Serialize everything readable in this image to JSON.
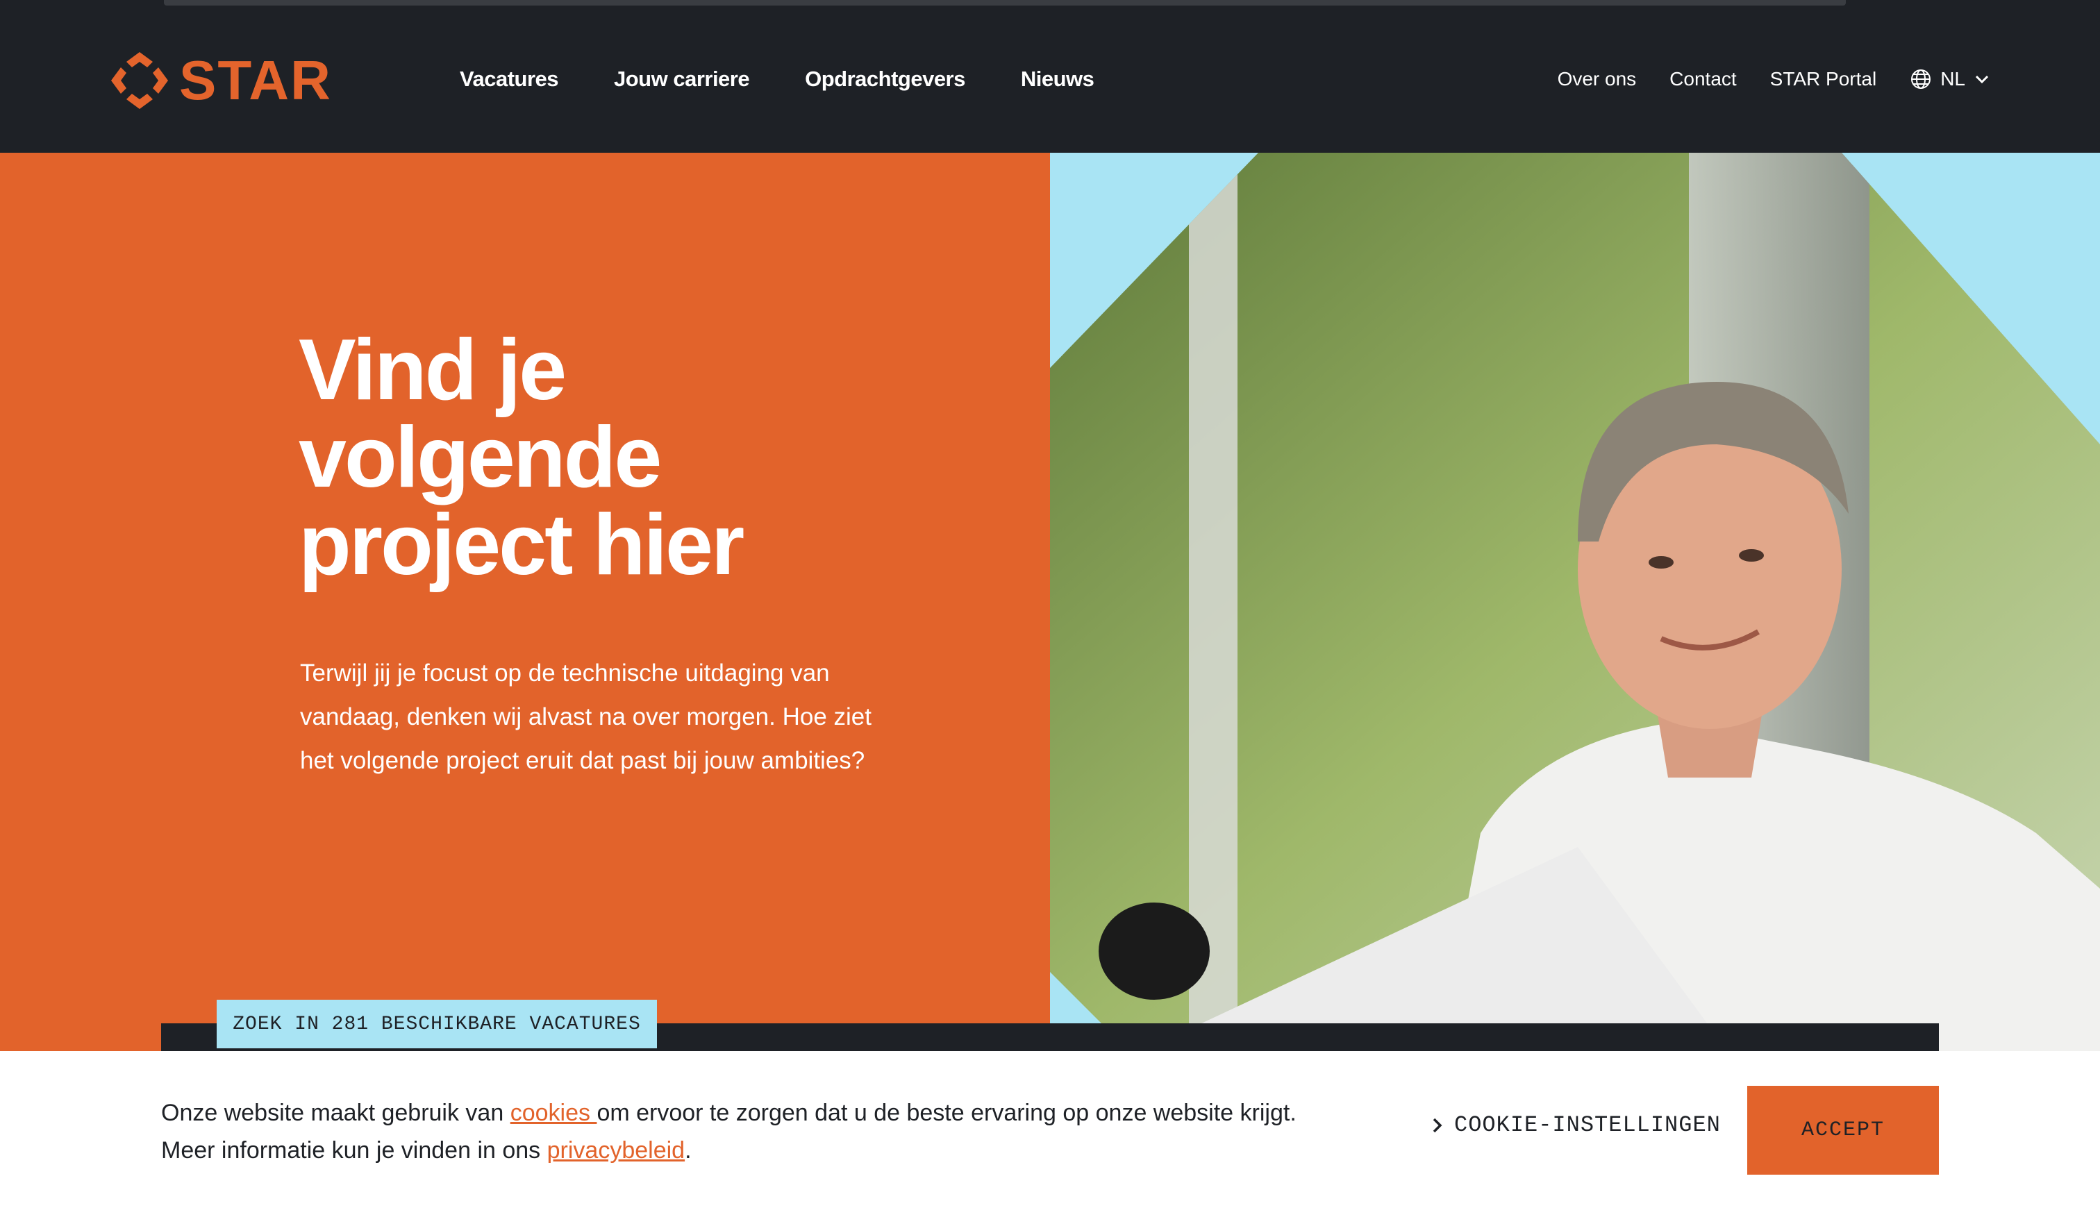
{
  "brand": {
    "name": "STAR",
    "accent": "#e2632b",
    "dark": "#1e2126",
    "light_blue": "#a9e4f4"
  },
  "nav": {
    "main": [
      "Vacatures",
      "Jouw carriere",
      "Opdrachtgevers",
      "Nieuws"
    ],
    "utility": [
      "Over ons",
      "Contact",
      "STAR Portal"
    ],
    "language": "NL",
    "language_icon": "globe-icon"
  },
  "hero": {
    "headline": "Vind je volgende project hier",
    "lead": "Terwijl jij je focust op de technische uitdaging van vandaag, denken wij alvast na over morgen. Hoe ziet het volgende project eruit dat past bij jouw ambities?",
    "search_tag": "ZOEK IN 281 BESCHIKBARE VACATURES"
  },
  "cookie": {
    "text_before": "Onze website maakt gebruik van ",
    "link_cookies": "cookies ",
    "text_after": "om ervoor te zorgen dat u de beste ervaring op onze website krijgt.",
    "text_line2": "Meer informatie kun je vinden in ons ",
    "link_privacy": "privacybeleid",
    "period": ".",
    "settings_label": "COOKIE-INSTELLINGEN",
    "accept_label": "ACCEPT"
  }
}
